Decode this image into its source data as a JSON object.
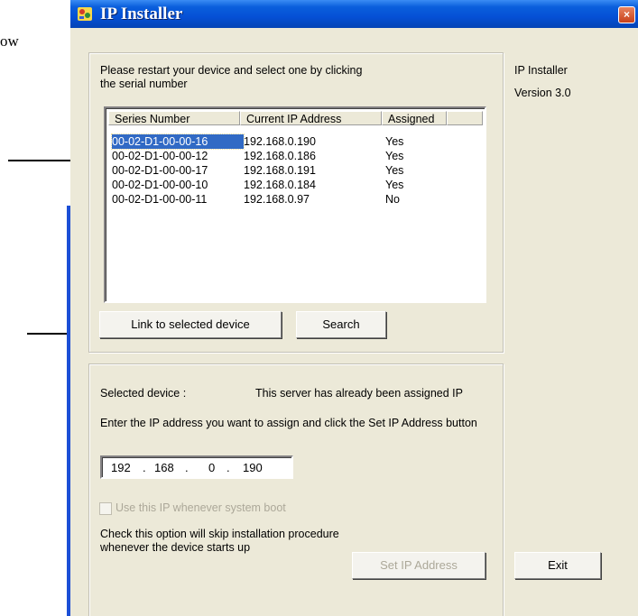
{
  "doc": {
    "fragment": "ow"
  },
  "window": {
    "title": "IP Installer",
    "close_label": "×"
  },
  "side": {
    "app_name": "IP Installer",
    "version": "Version 3.0"
  },
  "devices": {
    "instructions": "Please restart your device and select one by clicking the serial number",
    "columns": [
      "Series Number",
      "Current IP Address",
      "Assigned"
    ],
    "rows": [
      {
        "serial": "00-02-D1-00-00-16",
        "ip": "192.168.0.190",
        "assigned": "Yes",
        "selected": true
      },
      {
        "serial": "00-02-D1-00-00-12",
        "ip": "192.168.0.186",
        "assigned": "Yes"
      },
      {
        "serial": "00-02-D1-00-00-17",
        "ip": "192.168.0.191",
        "assigned": "Yes"
      },
      {
        "serial": "00-02-D1-00-00-10",
        "ip": "192.168.0.184",
        "assigned": "Yes"
      },
      {
        "serial": "00-02-D1-00-00-11",
        "ip": "192.168.0.97",
        "assigned": "No"
      }
    ],
    "link_button": "Link to selected device",
    "search_button": "Search"
  },
  "assign": {
    "selected_label": "Selected device :",
    "status_text": "This server has already been assigned IP",
    "prompt": "Enter the IP address you want to assign and click the Set IP Address button",
    "ip_octets": [
      "192",
      "168",
      "0",
      "190"
    ],
    "checkbox_label": "Use this IP whenever system boot",
    "checkbox_checked": false,
    "hint": "Check this option will skip installation procedure whenever the device starts up",
    "set_button": "Set IP Address"
  },
  "exit_button": "Exit",
  "colors": {
    "title_bar": "#0550d6",
    "selection": "#316ac5",
    "dialog_bg": "#ece9d8"
  }
}
